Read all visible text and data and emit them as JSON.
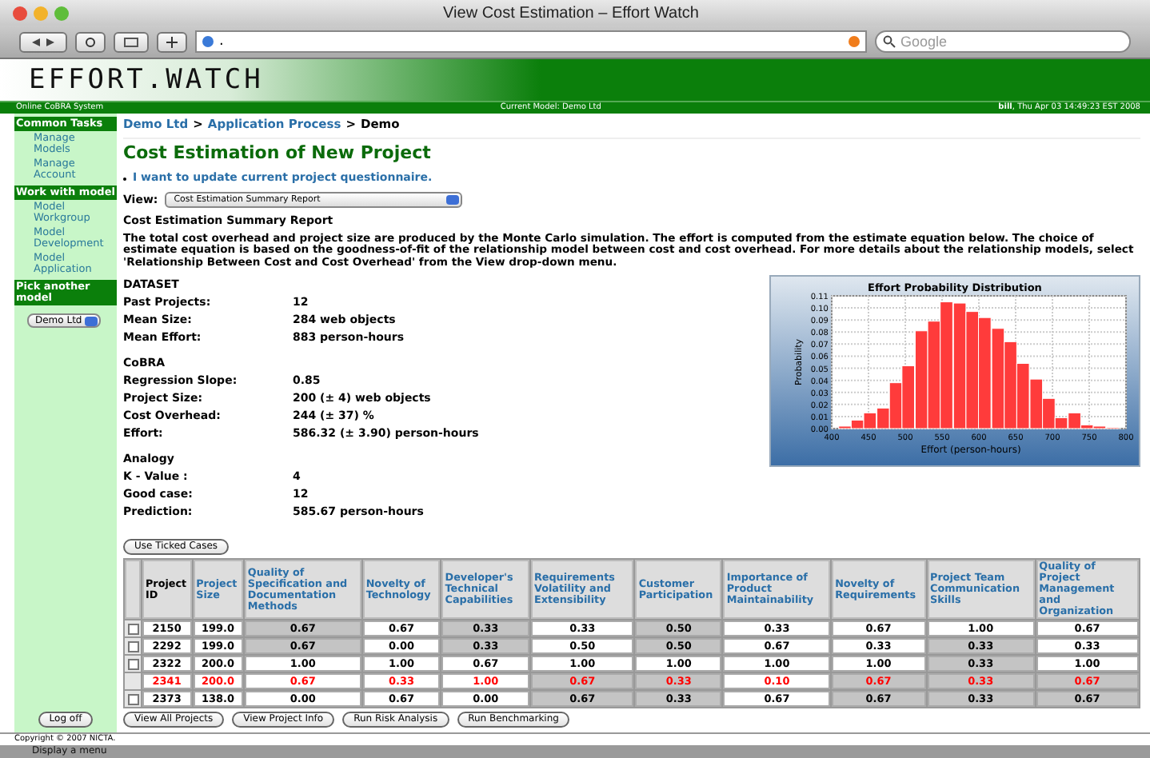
{
  "window": {
    "title": "View Cost Estimation – Effort Watch"
  },
  "browser": {
    "url": ".",
    "search_placeholder": "Google"
  },
  "app": {
    "logo": "EFFORT.WATCH",
    "system": "Online CoBRA System",
    "current_model": "Current Model: Demo Ltd",
    "user_time": "**bill**, Thu Apr 03 14:49:23 EST 2008"
  },
  "sidebar": {
    "sections": [
      {
        "title": "Common Tasks",
        "items": [
          "Manage Models",
          "Manage Account"
        ]
      },
      {
        "title": "Work with model",
        "items": [
          "Model Workgroup",
          "Model Development",
          "Model Application"
        ]
      },
      {
        "title": "Pick another model",
        "select": "Demo Ltd"
      }
    ]
  },
  "breadcrumb": [
    {
      "label": "Demo Ltd",
      "link": true
    },
    {
      "separator": ">"
    },
    {
      "label": "Application Process",
      "link": true
    },
    {
      "separator": ">"
    },
    {
      "label": "Demo",
      "link": false
    }
  ],
  "page_title": "Cost Estimation of New Project",
  "update_link": "I want to update current project questionnaire.",
  "view": {
    "label": "View:",
    "value": "Cost Estimation Summary Report"
  },
  "report_title": "Cost Estimation Summary Report",
  "description": "The total cost overhead and project size are produced by the Monte Carlo simulation. The effort is computed from the estimate equation below. The choice of estimate equation is based on the goodness-of-fit of the relationship model between cost and cost overhead. For more details about the relationship models, select 'Relationship Between Cost and Cost Overhead' from the View drop-down menu.",
  "groups": [
    {
      "title": "DATASET",
      "rows": [
        {
          "label": "Past Projects:",
          "value": "12"
        },
        {
          "label": "Mean Size:",
          "value": "284 web objects"
        },
        {
          "label": "Mean Effort:",
          "value": "883 person-hours"
        }
      ]
    },
    {
      "title": "CoBRA",
      "rows": [
        {
          "label": "Regression Slope:",
          "value": "0.85"
        },
        {
          "label": "Project Size:",
          "value": "200 (± 4) web objects"
        },
        {
          "label": "Cost Overhead:",
          "value": "244 (± 37) %"
        },
        {
          "label": "Effort:",
          "value": "586.32 (± 3.90) person-hours"
        }
      ]
    },
    {
      "title": "Analogy",
      "rows": [
        {
          "label": "K - Value :",
          "value": "4"
        },
        {
          "label": "Good case:",
          "value": "12"
        },
        {
          "label": "Prediction:",
          "value": "585.67 person-hours"
        }
      ]
    }
  ],
  "chart": {
    "chart_data": {
      "type": "bar",
      "title": "Effort Probability Distribution",
      "xlabel": "Effort (person-hours)",
      "ylabel": "Probability",
      "x": [
        418,
        435,
        452,
        470,
        487,
        504,
        522,
        539,
        556,
        574,
        591,
        608,
        626,
        643,
        660,
        678,
        695,
        712,
        730,
        747,
        764,
        782
      ],
      "grid": true,
      "series": [
        {
          "color": "#ff3b3b",
          "values": [
            0.002,
            0.007,
            0.013,
            0.017,
            0.038,
            0.052,
            0.081,
            0.089,
            0.105,
            0.104,
            0.097,
            0.092,
            0.083,
            0.072,
            0.054,
            0.041,
            0.025,
            0.009,
            0.013,
            0.003,
            0.002,
            0.001
          ]
        }
      ],
      "xlim": [
        400,
        800
      ],
      "ylim": [
        0,
        0.11
      ],
      "xticks": [
        400,
        450,
        500,
        550,
        600,
        650,
        700,
        750,
        800
      ],
      "yticks": [
        {
          "value": 0,
          "label": "0.00"
        },
        {
          "value": 0.01,
          "label": "0.01"
        },
        {
          "value": 0.02,
          "label": "0.02"
        },
        {
          "value": 0.03,
          "label": "0.03"
        },
        {
          "value": 0.04,
          "label": "0.04"
        },
        {
          "value": 0.05,
          "label": "0.05"
        },
        {
          "value": 0.06,
          "label": "0.06"
        },
        {
          "value": 0.07,
          "label": "0.07"
        },
        {
          "value": 0.08,
          "label": "0.08"
        },
        {
          "value": 0.09,
          "label": "0.09"
        },
        {
          "value": 0.1,
          "label": "0.10"
        },
        {
          "value": 0.11,
          "label": "0.11"
        }
      ]
    }
  },
  "use_ticked_button": "Use Ticked Cases",
  "table": {
    "columns": [
      {
        "label": "Project ID",
        "link": false
      },
      {
        "label": "Project Size",
        "link": true
      },
      {
        "label": "Quality of Specification and Documentation Methods",
        "link": true
      },
      {
        "label": "Novelty of Technology",
        "link": true
      },
      {
        "label": "Developer's Technical Capabilities",
        "link": true
      },
      {
        "label": "Requirements Volatility and Extensibility",
        "link": true
      },
      {
        "label": "Customer Participation",
        "link": true
      },
      {
        "label": "Importance of Product Maintainability",
        "link": true
      },
      {
        "label": "Novelty of Requirements",
        "link": true
      },
      {
        "label": "Project Team Communication Skills",
        "link": true
      },
      {
        "label": "Quality of Project Management and Organization",
        "link": true
      }
    ],
    "rows": [
      {
        "kind": "case",
        "checked": false,
        "cells": [
          {
            "value": "2150",
            "shaded": false
          },
          {
            "value": "199.0",
            "shaded": false
          },
          {
            "value": "0.67",
            "shaded": true
          },
          {
            "value": "0.67",
            "shaded": false
          },
          {
            "value": "0.33",
            "shaded": true
          },
          {
            "value": "0.33",
            "shaded": false
          },
          {
            "value": "0.50",
            "shaded": true
          },
          {
            "value": "0.33",
            "shaded": false
          },
          {
            "value": "0.67",
            "shaded": false
          },
          {
            "value": "1.00",
            "shaded": false
          },
          {
            "value": "0.67",
            "shaded": false
          }
        ]
      },
      {
        "kind": "case",
        "checked": false,
        "cells": [
          {
            "value": "2292",
            "shaded": false
          },
          {
            "value": "199.0",
            "shaded": false
          },
          {
            "value": "0.67",
            "shaded": true
          },
          {
            "value": "0.00",
            "shaded": false
          },
          {
            "value": "0.33",
            "shaded": true
          },
          {
            "value": "0.50",
            "shaded": false
          },
          {
            "value": "0.50",
            "shaded": true
          },
          {
            "value": "0.67",
            "shaded": false
          },
          {
            "value": "0.33",
            "shaded": false
          },
          {
            "value": "0.33",
            "shaded": true
          },
          {
            "value": "0.33",
            "shaded": false
          }
        ]
      },
      {
        "kind": "case",
        "checked": false,
        "cells": [
          {
            "value": "2322",
            "shaded": false
          },
          {
            "value": "200.0",
            "shaded": false
          },
          {
            "value": "1.00",
            "shaded": false
          },
          {
            "value": "1.00",
            "shaded": false
          },
          {
            "value": "0.67",
            "shaded": false
          },
          {
            "value": "1.00",
            "shaded": false
          },
          {
            "value": "1.00",
            "shaded": false
          },
          {
            "value": "1.00",
            "shaded": false
          },
          {
            "value": "1.00",
            "shaded": false
          },
          {
            "value": "0.33",
            "shaded": true
          },
          {
            "value": "1.00",
            "shaded": false
          }
        ]
      },
      {
        "kind": "current",
        "cells": [
          {
            "value": "2341",
            "shaded": false
          },
          {
            "value": "200.0",
            "shaded": false
          },
          {
            "value": "0.67",
            "shaded": false
          },
          {
            "value": "0.33",
            "shaded": false
          },
          {
            "value": "1.00",
            "shaded": false
          },
          {
            "value": "0.67",
            "shaded": true
          },
          {
            "value": "0.33",
            "shaded": true
          },
          {
            "value": "0.10",
            "shaded": false
          },
          {
            "value": "0.67",
            "shaded": true
          },
          {
            "value": "0.33",
            "shaded": true
          },
          {
            "value": "0.67",
            "shaded": true
          }
        ]
      },
      {
        "kind": "case",
        "checked": false,
        "cells": [
          {
            "value": "2373",
            "shaded": false
          },
          {
            "value": "138.0",
            "shaded": false
          },
          {
            "value": "0.00",
            "shaded": false
          },
          {
            "value": "0.67",
            "shaded": false
          },
          {
            "value": "0.00",
            "shaded": false
          },
          {
            "value": "0.67",
            "shaded": true
          },
          {
            "value": "0.33",
            "shaded": true
          },
          {
            "value": "0.67",
            "shaded": false
          },
          {
            "value": "0.67",
            "shaded": true
          },
          {
            "value": "0.33",
            "shaded": true
          },
          {
            "value": "0.67",
            "shaded": true
          }
        ]
      }
    ]
  },
  "buttons": [
    "Log off",
    "View All Projects",
    "View Project Info",
    "Run Risk Analysis",
    "Run Benchmarking"
  ],
  "copyright": "Copyright © 2007 NICTA.",
  "status_bar": "Display a menu"
}
